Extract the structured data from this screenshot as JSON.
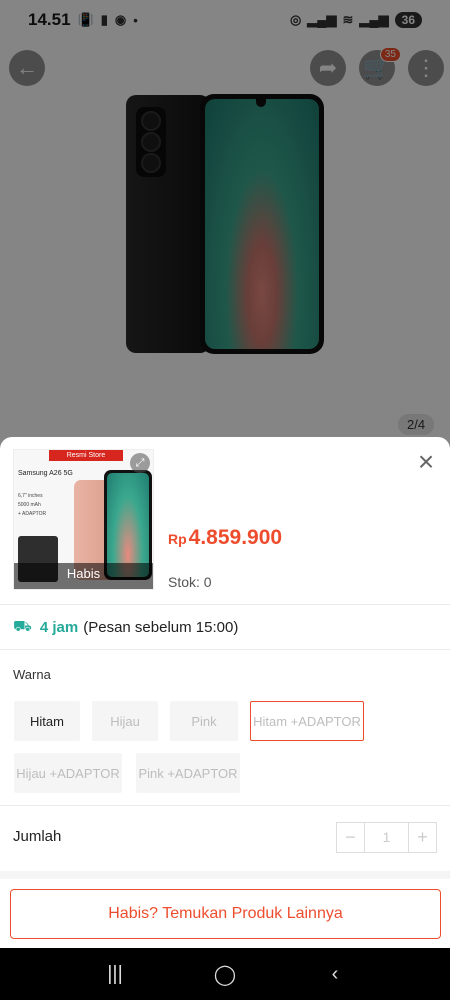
{
  "status_bar": {
    "time": "14.51",
    "battery": "36"
  },
  "product_header": {
    "cart_count": "35",
    "image_counter": "2/4"
  },
  "thumbnail": {
    "store_banner": "Resmi Store",
    "title": "Samsung A26 5G",
    "spec_1": "6,7\" inches",
    "spec_2": "5000 mAh",
    "spec_3": "+ ADAPTOR",
    "sold_out_label": "Habis"
  },
  "product": {
    "currency": "Rp",
    "price": "4.859.900",
    "stock": "Stok: 0"
  },
  "delivery": {
    "time": "4 jam",
    "note": "(Pesan sebelum 15:00)"
  },
  "variants": {
    "label": "Warna",
    "options": [
      {
        "label": "Hitam",
        "state": "available"
      },
      {
        "label": "Hijau",
        "state": "disabled"
      },
      {
        "label": "Pink",
        "state": "disabled"
      },
      {
        "label": "Hitam +ADAPTOR",
        "state": "selected"
      },
      {
        "label": "Hijau +ADAPTOR",
        "state": "disabled"
      },
      {
        "label": "Pink +ADAPTOR",
        "state": "disabled"
      }
    ]
  },
  "quantity": {
    "label": "Jumlah",
    "value": "1",
    "minus": "−",
    "plus": "+"
  },
  "cta": {
    "label": "Habis? Temukan Produk Lainnya"
  },
  "colors": {
    "accent": "#ee4d2d",
    "delivery": "#26aa99"
  }
}
